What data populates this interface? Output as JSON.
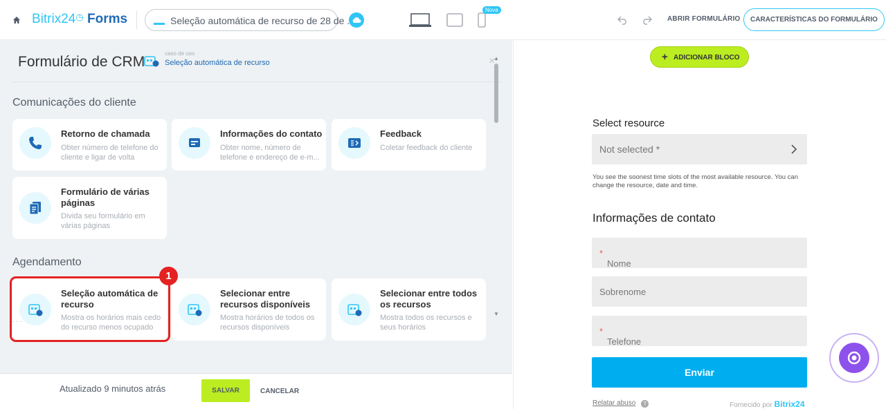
{
  "topbar": {
    "brand_name": "Bitrix24",
    "brand_product": "Forms",
    "form_name": "Seleção automática de recurso de 28 de ...",
    "new_badge": "Nova",
    "open_form": "ABRIR FORMULÁRIO",
    "form_characteristics": "CARACTERÍSTICAS DO FORMULÁRIO"
  },
  "panel": {
    "title": "Formulário de CRM",
    "usecase_caption": "caso de uso",
    "usecase_value": "Seleção automática de recurso",
    "close": "×"
  },
  "sections": {
    "communications": "Comunicações do cliente",
    "scheduling": "Agendamento",
    "next_partial": ". . ."
  },
  "cards": {
    "callback": {
      "title": "Retorno de chamada",
      "desc": "Obter número de telefone do cliente e ligar de volta",
      "icon": "phone-icon"
    },
    "contact_info": {
      "title": "Informações do contato",
      "desc": "Obter nome, número de telefone e endereço de e-m...",
      "icon": "contact-card-icon"
    },
    "feedback": {
      "title": "Feedback",
      "desc": "Coletar feedback do cliente",
      "icon": "feedback-icon"
    },
    "multipage": {
      "title": "Formulário de várias páginas",
      "desc": "Divida seu formulário em várias páginas",
      "icon": "pages-icon"
    },
    "auto_select": {
      "title": "Seleção automática de recurso",
      "desc": "Mostra os horários mais cedo do recurso menos ocupado",
      "icon": "calendar-auto-icon"
    },
    "select_available": {
      "title": "Selecionar entre recursos disponíveis",
      "desc": "Mostra horários de todos os recursos disponíveis",
      "icon": "calendar-auto-icon"
    },
    "select_all": {
      "title": "Selecionar entre todos os recursos",
      "desc": "Mostra todos os recursos e seus horários",
      "icon": "calendar-auto-icon"
    }
  },
  "annotation": {
    "number": "1"
  },
  "footer": {
    "updated": "Atualizado 9 minutos atrás",
    "save": "SALVAR",
    "cancel": "CANCELAR"
  },
  "preview": {
    "add_block": "ADICIONAR BLOCO",
    "select_resource_title": "Select resource",
    "select_value": "Not selected *",
    "select_hint": "You see the soonest time slots of the most available resource. You can change the resource, date and time.",
    "contact_title": "Informações de contato",
    "field_name": "Nome",
    "field_surname": "Sobrenome",
    "field_phone": "Telefone",
    "required_mark": "*",
    "send": "Enviar",
    "report_abuse": "Relatar abuso",
    "help": "?",
    "powered_prefix": "Fornecido por",
    "powered_brand": "Bitrix24"
  },
  "colors": {
    "accent": "#2fc6f6",
    "save_green": "#bbed21",
    "highlight_red": "#e52222",
    "send_blue": "#00aeef"
  }
}
